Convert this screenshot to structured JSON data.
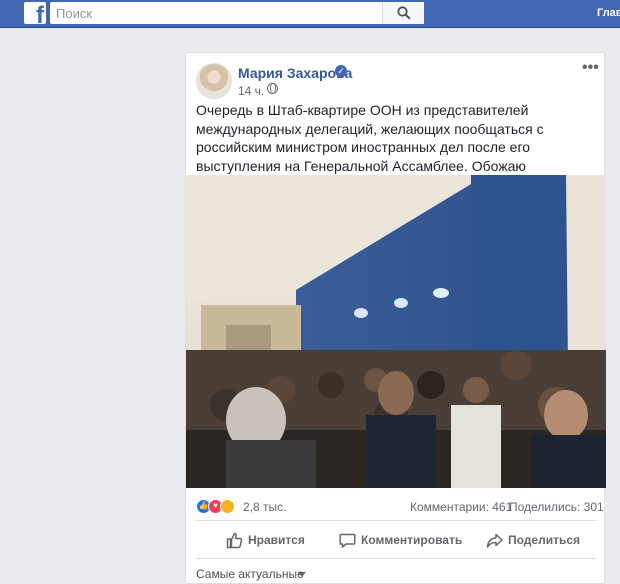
{
  "topbar": {
    "search_placeholder": "Поиск",
    "home_label": "Главная",
    "brand_color": "#4267b2"
  },
  "post": {
    "author": "Мария Захарова",
    "time": "14 ч.",
    "text": "Очередь в Штаб-квартире ООН из представителей международных делегаций, желающих пообщаться с российским министром иностранных дел после его выступления на Генеральной Ассамблее. Обожаю наблюдать за «изоляцией России»",
    "icons": {
      "verified": "verified-badge-icon",
      "privacy": "globe-icon",
      "menu": "more-options-icon",
      "emoji": "grinning-emoji-icon"
    }
  },
  "stats": {
    "reactions": "2,8 тыс.",
    "comments": "Комментарии: 461",
    "shares": "Поделились: 301"
  },
  "actions": {
    "like": "Нравится",
    "comment": "Комментировать",
    "share": "Поделиться"
  },
  "comments": {
    "sort_label": "Самые актуальные"
  }
}
